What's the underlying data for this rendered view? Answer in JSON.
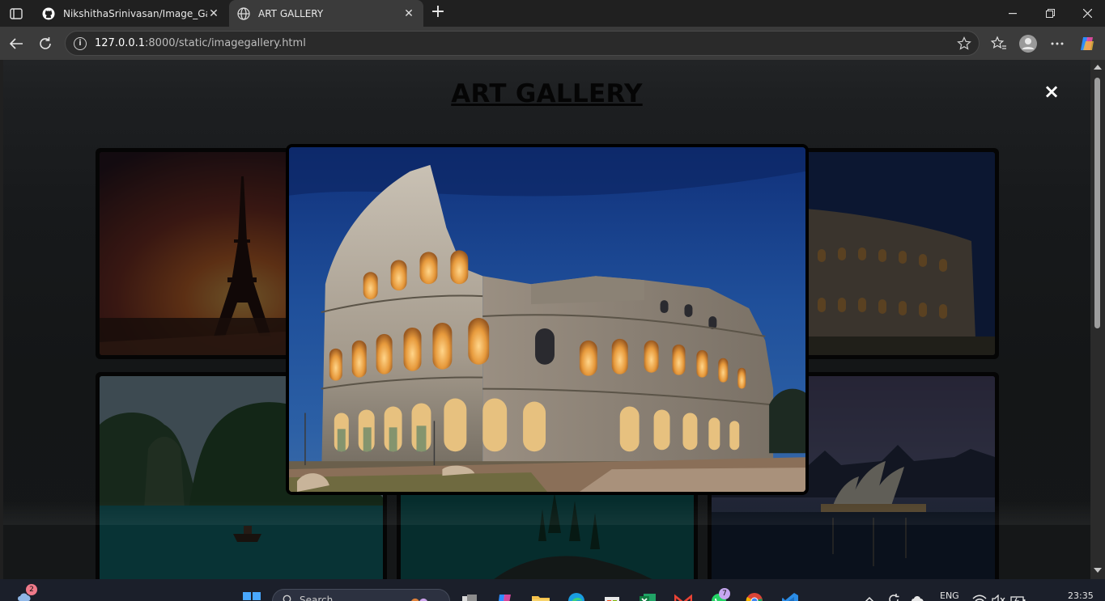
{
  "browser": {
    "tabs": [
      {
        "title": "NikshithaSrinivasan/Image_Gallery",
        "icon": "github-icon",
        "active": false
      },
      {
        "title": "ART GALLERY",
        "icon": "globe-icon",
        "active": true
      }
    ],
    "url_host": "127.0.0.1",
    "url_rest": ":8000/static/imagegallery.html",
    "window_controls": [
      "minimize",
      "restore",
      "close"
    ]
  },
  "page": {
    "title": "ART GALLERY",
    "close_symbol": "×",
    "gallery": [
      {
        "name": "eiffel-tower"
      },
      {
        "name": "colosseum-thumbnail"
      },
      {
        "name": "halong-bay"
      },
      {
        "name": "mountain-lake"
      },
      {
        "name": "sydney-opera-house"
      }
    ],
    "lightbox": {
      "image": "colosseum"
    }
  },
  "taskbar": {
    "weather_badge": "2",
    "search_placeholder": "Search",
    "whatsapp_badge": "7",
    "language": "ENG",
    "time": "23:35"
  },
  "colors": {
    "modal_dim": "#000000",
    "title_text": "#050505",
    "close_icon": "#ffffff"
  }
}
